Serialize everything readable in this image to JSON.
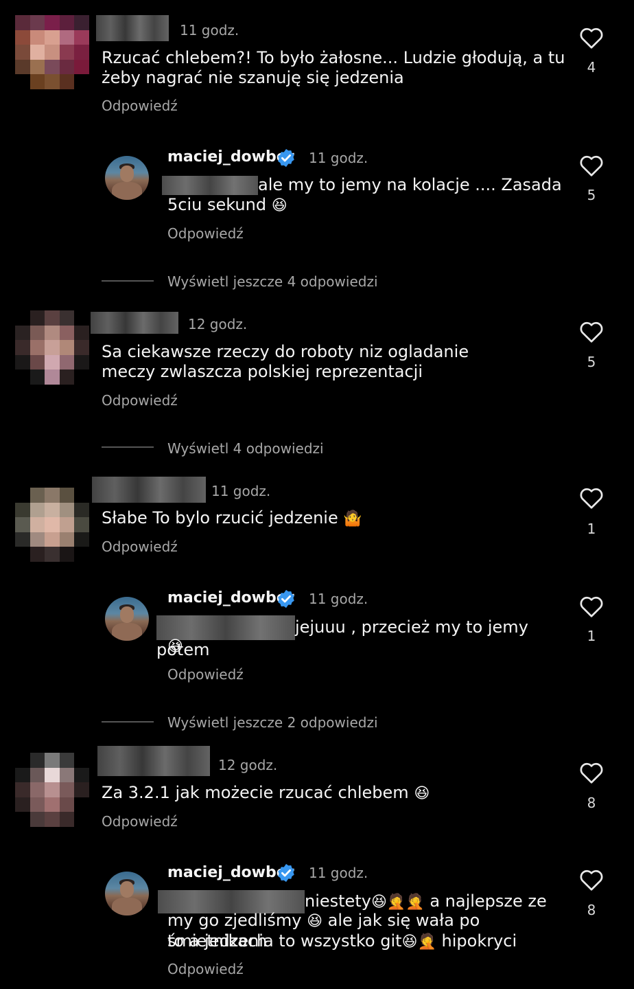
{
  "comments": [
    {
      "time": "11 godz.",
      "text": "Rzucać chlebem?! To było żałosne... Ludzie głodują, a tu żeby nagrać nie szanuję się jedzenia",
      "reply_label": "Odpowiedź",
      "likes": "4"
    },
    {
      "time": "12 godz.",
      "text": "Sa ciekawsze rzeczy do roboty niz ogladanie meczy zwlaszcza polskiej reprezentacji",
      "reply_label": "Odpowiedź",
      "likes": "5"
    },
    {
      "time": "11 godz.",
      "text": "Słabe To bylo  rzucić  jedzenie",
      "reply_label": "Odpowiedź",
      "likes": "1"
    },
    {
      "time": "12 godz.",
      "text": "Za 3.2.1 jak możecie rzucać chlebem",
      "reply_label": "Odpowiedź",
      "likes": "8"
    }
  ],
  "replies": [
    {
      "username": "maciej_dowbor",
      "time": "11 godz.",
      "text_a": "ale my to jemy na kolacje .... Zasada",
      "text_b": "5ciu sekund",
      "reply_label": "Odpowiedź",
      "likes": "5"
    },
    {
      "username": "maciej_dowbor",
      "time": "11 godz.",
      "text_a": "jejuuu , przecież my to jemy potem",
      "text_b": "",
      "reply_label": "Odpowiedź",
      "likes": "1"
    },
    {
      "username": "maciej_dowbor",
      "time": "11 godz.",
      "text_a": "niestety",
      "text_a2": "a najlepsze ze",
      "text_b": "my go zjedliśmy",
      "text_b2": "ale jak się wała po śmietnikach",
      "text_c": "to a jedzenia to wszystko git",
      "text_c2": "hipokryci",
      "reply_label": "Odpowiedź",
      "likes": "8"
    }
  ],
  "view_more": [
    "Wyświetl jeszcze 4 odpowiedzi",
    "Wyświetl 4 odpowiedzi",
    "Wyświetl jeszcze 2 odpowiedzi"
  ],
  "icons": {
    "heart": "heart-icon",
    "verified": "verified-badge-icon",
    "laugh": "😆",
    "facepalm": "🤦",
    "shrug": "🤷"
  },
  "colors": {
    "background": "#000000",
    "text": "#f5f5f5",
    "secondary": "#a8a8a8",
    "verified": "#3897f0"
  }
}
